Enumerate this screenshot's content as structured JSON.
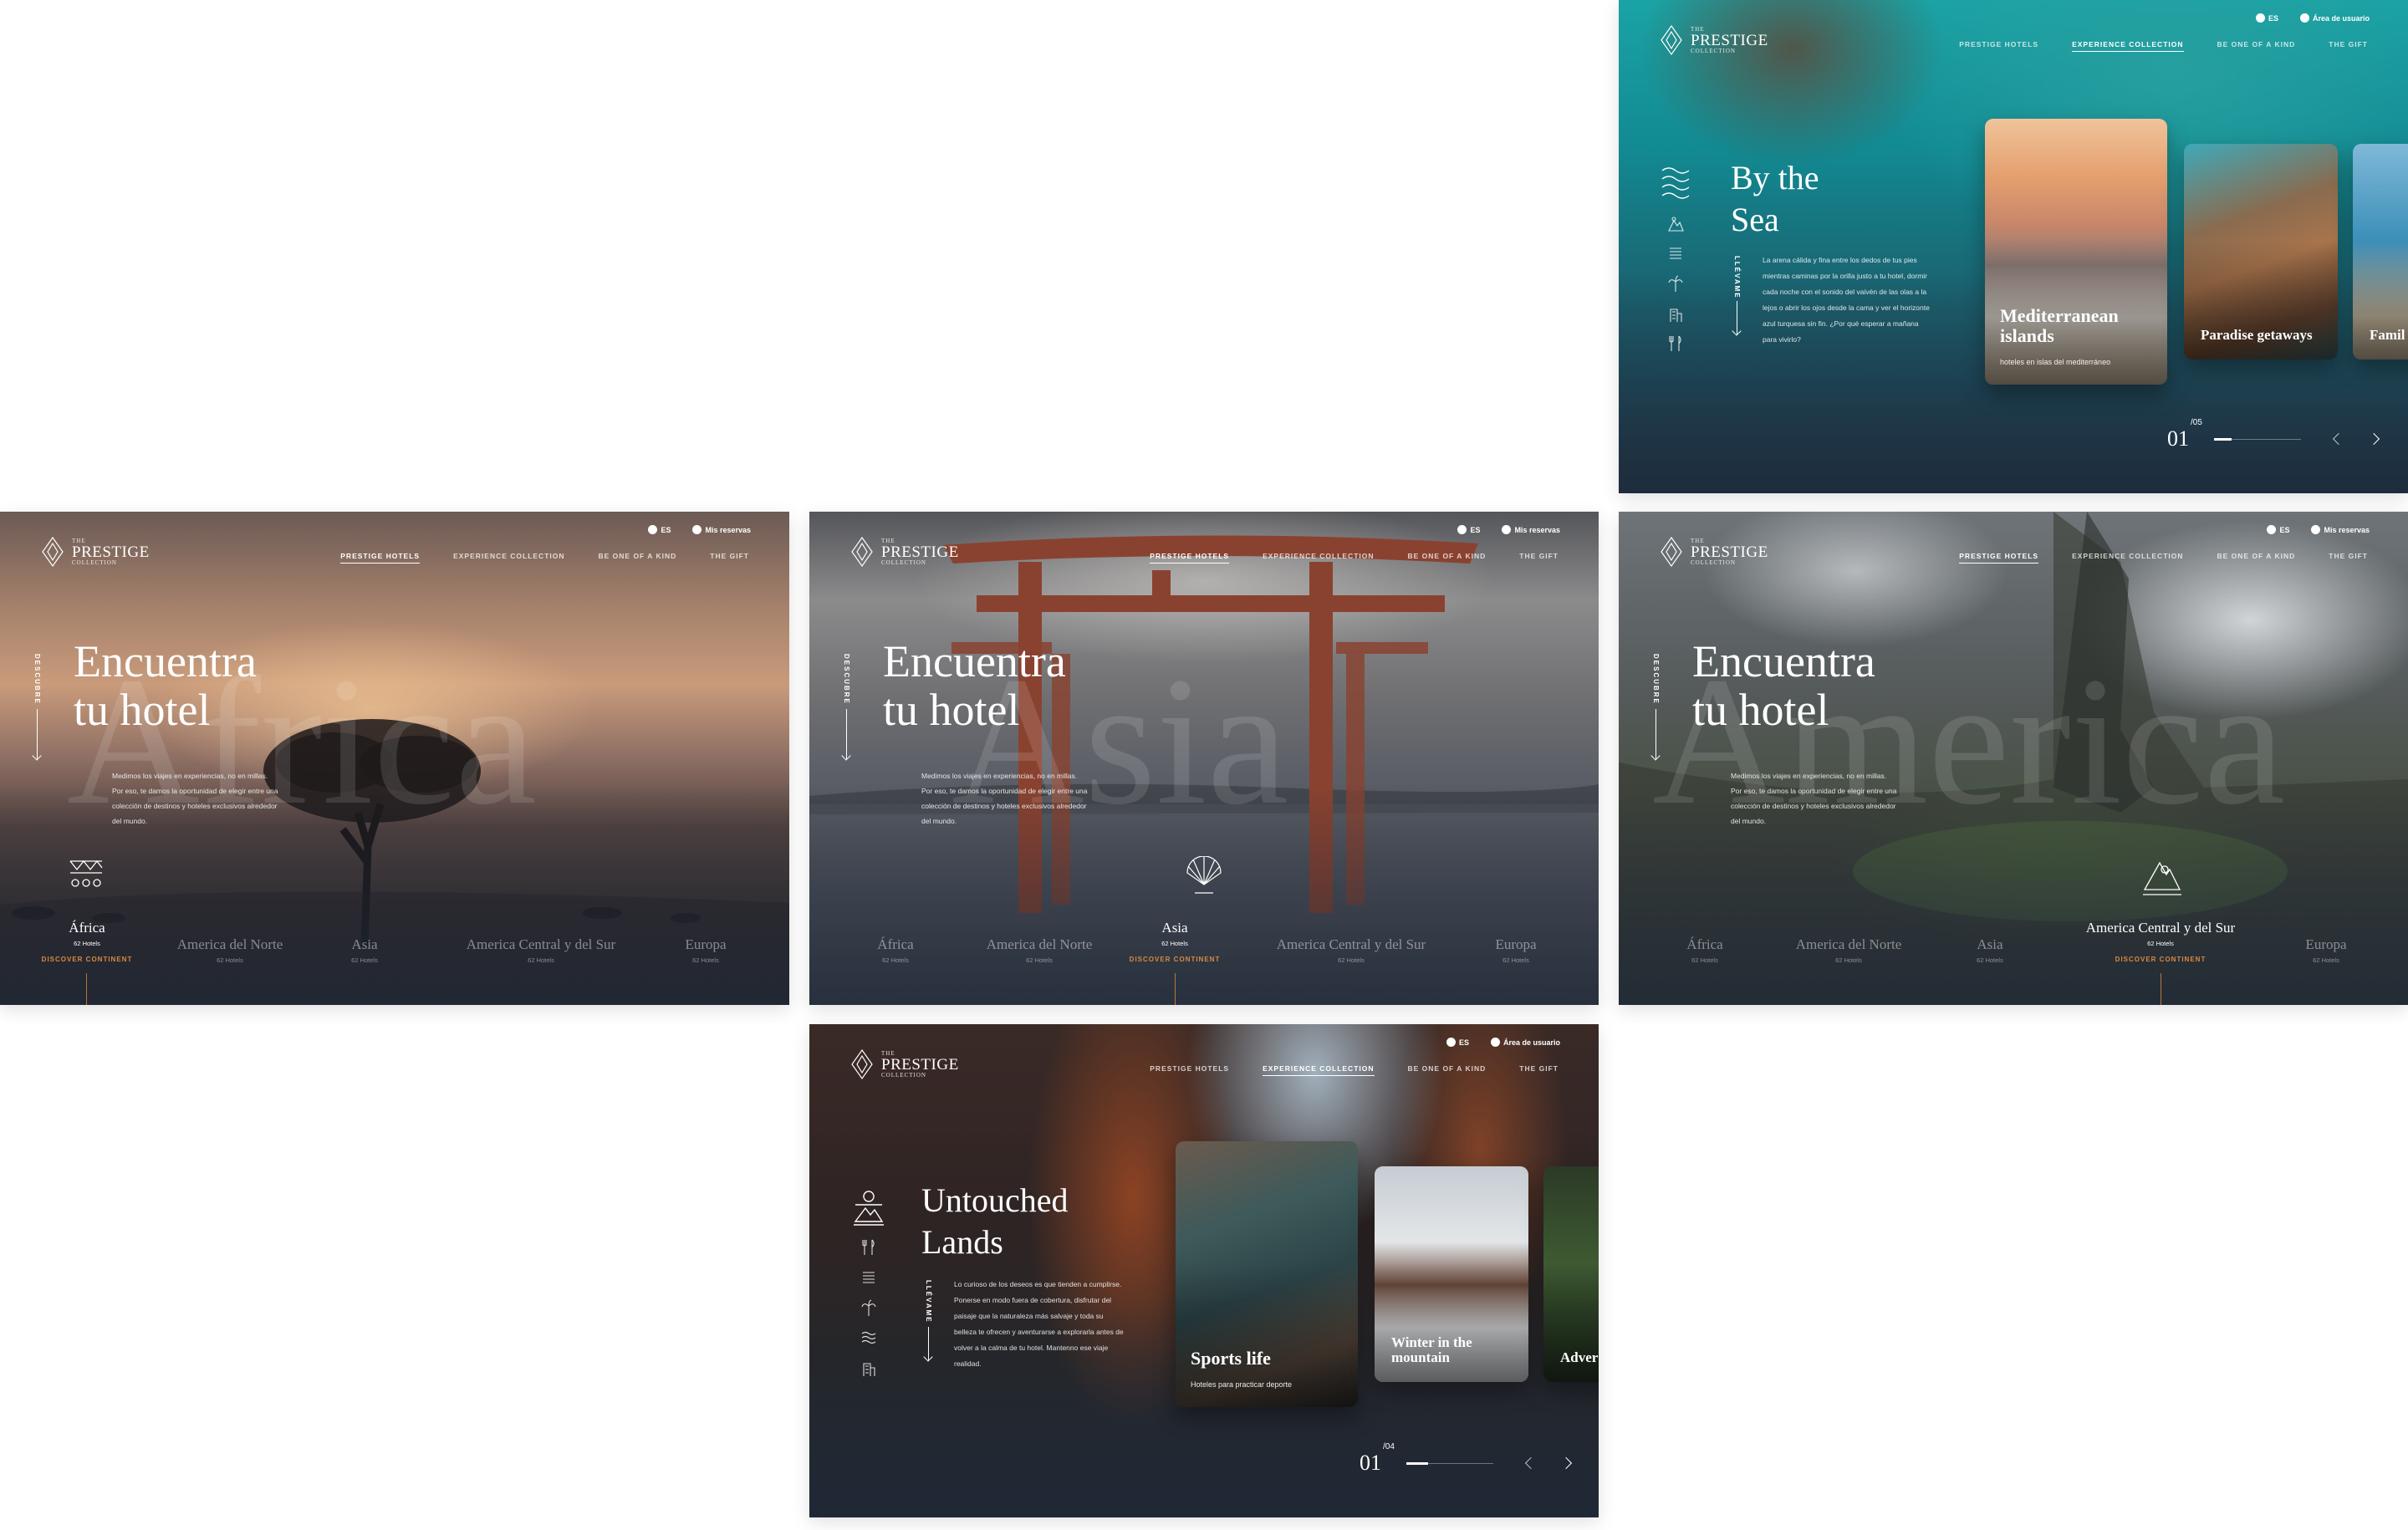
{
  "brand": {
    "the": "THE",
    "name": "PRESTIGE",
    "collection": "COLLECTION"
  },
  "nav": [
    "PRESTIGE HOTELS",
    "EXPERIENCE COLLECTION",
    "BE ONE OF A KIND",
    "THE GIFT"
  ],
  "lang": "ES",
  "account": {
    "bookings": "Mis reservas",
    "user_area": "Área de usuario"
  },
  "hero": {
    "title_line1": "Encuentra",
    "title_line2": "tu hotel",
    "vertical_label": "DESCUBRE",
    "description": "Medimos los viajes en experiencias, no en millas. Por eso, te damos la oportunidad de elegir entre una colección de destinos y hoteles exclusivos alrededor del mundo.",
    "discover": "DISCOVER CONTINENT"
  },
  "continents": [
    {
      "name": "África",
      "count": "62 Hotels"
    },
    {
      "name": "America del Norte",
      "count": "62 Hotels"
    },
    {
      "name": "Asia",
      "count": "62 Hotels"
    },
    {
      "name": "America Central y del Sur",
      "count": "62 Hotels"
    },
    {
      "name": "Europa",
      "count": "62 Hotels"
    }
  ],
  "watermarks": {
    "africa": "Africa",
    "asia": "Asia",
    "america": "America"
  },
  "sea": {
    "title_line1": "By the",
    "title_line2": "Sea",
    "vertical_label": "LLÉVAME",
    "description": "La arena cálida y fina entre los dedos de tus pies mientras caminas por la orilla justo a tu hotel, dormir cada noche con el sonido del vaivén de las olas a la lejos o abrir los ojos desde la cama y ver el horizonte azul turquesa sin fin. ¿Por qué esperar a mañana para vivirlo?",
    "cards": [
      {
        "title_line1": "Mediterranean",
        "title_line2": "islands",
        "subtitle": "hoteles en islas del mediterráneo"
      },
      {
        "title": "Paradise getaways"
      },
      {
        "title": "Famil"
      }
    ],
    "pager": {
      "current": "01",
      "total": "/05",
      "progress": 0.2
    }
  },
  "lands": {
    "title_line1": "Untouched",
    "title_line2": "Lands",
    "vertical_label": "LLÉVAME",
    "description": "Lo curioso de los deseos es que tienden a cumplirse. Ponerse en modo fuera de cobertura, disfrutar del paisaje que la naturaleza más salvaje y toda su belleza te ofrecen y aventurarse a explorarla antes de volver a la calma de tu hotel. Mantenno ese viaje realidad.",
    "cards": [
      {
        "title": "Sports life",
        "subtitle": "Hoteles para practicar deporte"
      },
      {
        "title_line1": "Winter in the",
        "title_line2": "mountain"
      },
      {
        "title": "Adver"
      }
    ],
    "pager": {
      "current": "01",
      "total": "/04",
      "progress": 0.25
    }
  },
  "colors": {
    "accent": "#d98a3e",
    "text": "#ffffff"
  }
}
